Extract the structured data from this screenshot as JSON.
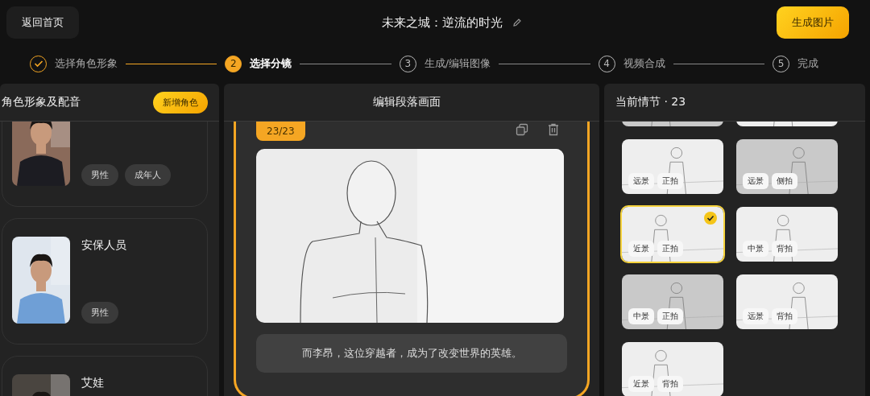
{
  "header": {
    "back_button": "返回首页",
    "title": "未来之城：逆流的时光",
    "generate_button": "生成图片"
  },
  "steps": [
    {
      "label": "选择角色形象",
      "done": true,
      "selected": false
    },
    {
      "number": "2",
      "label": "选择分镜",
      "done": false,
      "selected": true
    },
    {
      "number": "3",
      "label": "生成/编辑图像",
      "done": false,
      "selected": false
    },
    {
      "number": "4",
      "label": "视频合成",
      "done": false,
      "selected": false
    },
    {
      "number": "5",
      "label": "完成",
      "done": false,
      "selected": false
    }
  ],
  "characters_panel": {
    "title": "角色形象及配音",
    "add_button": "新增角色",
    "characters": [
      {
        "tags": [
          "男性",
          "成年人"
        ]
      },
      {
        "name": "安保人员",
        "tags": [
          "男性"
        ]
      },
      {
        "name": "艾娃"
      }
    ]
  },
  "editor_panel": {
    "title": "编辑段落画面",
    "badge": "23/23",
    "caption": "而李昂，这位穿越者，成为了改变世界的英雄。"
  },
  "scenes_panel": {
    "title": "当前情节 · 23",
    "frames": [
      {
        "selected": false
      },
      {
        "selected": false
      },
      {
        "selected": false,
        "tags": [
          "远景",
          "正拍"
        ]
      },
      {
        "selected": false,
        "tags": [
          "远景",
          "侧拍"
        ]
      },
      {
        "selected": true,
        "tags": [
          "近景",
          "正拍"
        ]
      },
      {
        "selected": false,
        "tags": [
          "中景",
          "背拍"
        ]
      },
      {
        "selected": false,
        "tags": [
          "中景",
          "正拍"
        ]
      },
      {
        "selected": false,
        "tags": [
          "远景",
          "背拍"
        ]
      },
      {
        "selected": false,
        "tags": [
          "近景",
          "背拍"
        ]
      }
    ]
  }
}
